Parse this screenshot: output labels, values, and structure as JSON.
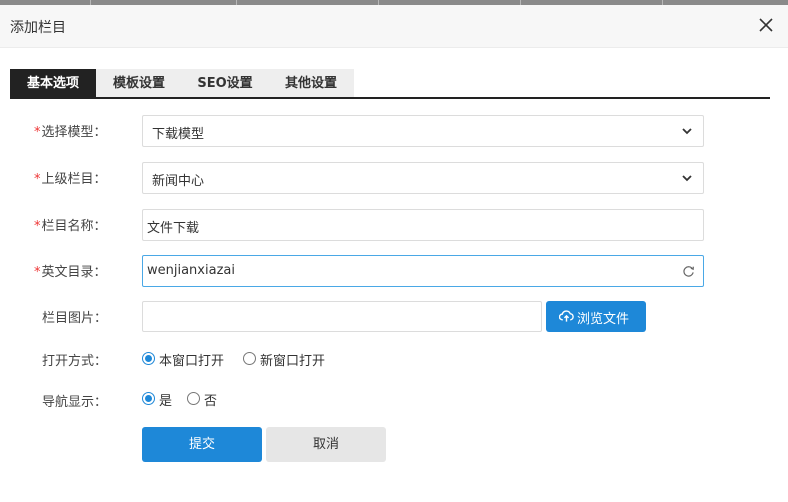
{
  "dialog": {
    "title": "添加栏目"
  },
  "tabs": [
    {
      "label": "基本选项",
      "active": true
    },
    {
      "label": "模板设置",
      "active": false
    },
    {
      "label": "SEO设置",
      "active": false
    },
    {
      "label": "其他设置",
      "active": false
    }
  ],
  "form": {
    "required_mark": "*",
    "model": {
      "label": "选择模型：",
      "value": "下载模型"
    },
    "parent": {
      "label": "上级栏目：",
      "value": "新闻中心"
    },
    "name": {
      "label": "栏目名称：",
      "value": "文件下载"
    },
    "dir": {
      "label": "英文目录：",
      "value": "wenjianxiazai"
    },
    "image": {
      "label": "栏目图片：",
      "value": "",
      "browse_label": "浏览文件"
    },
    "open_mode": {
      "label": "打开方式：",
      "options": [
        {
          "label": "本窗口打开",
          "checked": true
        },
        {
          "label": "新窗口打开",
          "checked": false
        }
      ]
    },
    "nav_show": {
      "label": "导航显示：",
      "options": [
        {
          "label": "是",
          "checked": true
        },
        {
          "label": "否",
          "checked": false
        }
      ]
    },
    "submit_label": "提交",
    "cancel_label": "取消"
  },
  "colors": {
    "primary": "#1e88d8",
    "required": "#e33333",
    "tab_active_bg": "#222222"
  },
  "icons": {
    "close": "close-icon",
    "select_arrow": "chevron-down-icon",
    "refresh": "refresh-icon",
    "upload": "cloud-upload-icon"
  }
}
